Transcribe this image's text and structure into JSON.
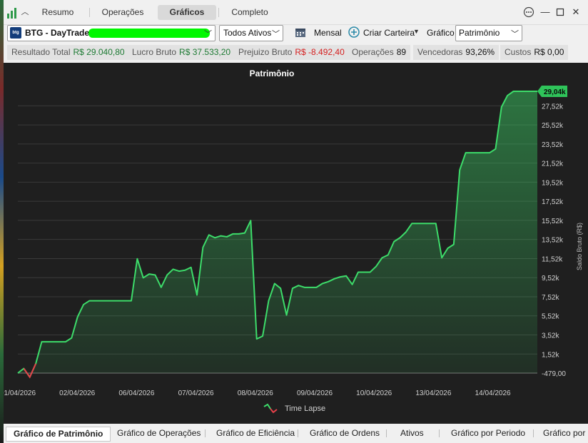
{
  "top_tabs": [
    {
      "label": "Resumo",
      "active": false
    },
    {
      "label": "Operações",
      "active": false
    },
    {
      "label": "Gráficos",
      "active": true
    },
    {
      "label": "Completo",
      "active": false
    }
  ],
  "window_controls": {
    "more": "more-icon",
    "minimize": "minimize-icon",
    "maximize": "maximize-icon",
    "close": "close-icon"
  },
  "toolbar": {
    "account_logo": "btg",
    "account": "BTG - DayTrade",
    "asset_filter": "Todos Ativos",
    "period_label": "Mensal",
    "create_portfolio": "Criar Carteira",
    "chart_label": "Gráfico",
    "chart_type": "Patrimônio"
  },
  "stats": [
    {
      "label": "Resultado Total",
      "value": "R$ 29.040,80",
      "tone": "green"
    },
    {
      "label": "Lucro Bruto",
      "value": "R$ 37.533,20",
      "tone": "green"
    },
    {
      "label": "Prejuizo Bruto",
      "value": "R$ -8.492,40",
      "tone": "red"
    },
    {
      "label": "Operações",
      "value": "89",
      "tone": "dark"
    },
    {
      "label": "Vencedoras",
      "value": "93,26%",
      "tone": "dark"
    },
    {
      "label": "Custos",
      "value": "R$ 0,00",
      "tone": "dark"
    }
  ],
  "colors": {
    "line": "#3ddc6a",
    "negative": "#e8414a",
    "background": "#1f1f1f",
    "grid": "#3a3a3a",
    "current_badge": "#2fc45a"
  },
  "chart_data": {
    "type": "area",
    "title": "Patrimônio",
    "ylabel": "Saldo Bruto (R$)",
    "ylim": [
      -479,
      29040
    ],
    "y_ticks": [
      "27,52k",
      "25,52k",
      "23,52k",
      "21,52k",
      "19,52k",
      "17,52k",
      "15,52k",
      "13,52k",
      "11,52k",
      "9,52k",
      "7,52k",
      "5,52k",
      "3,52k",
      "1,52k",
      "-479,00"
    ],
    "y_tick_values": [
      27520,
      25520,
      23520,
      21520,
      19520,
      17520,
      15520,
      13520,
      11520,
      9520,
      7520,
      5520,
      3520,
      1520,
      -479
    ],
    "current_value_label": "29,04k",
    "x_ticks": [
      "01/04/2026",
      "02/04/2026",
      "06/04/2026",
      "07/04/2026",
      "08/04/2026",
      "09/04/2026",
      "10/04/2026",
      "13/04/2026",
      "14/04/2026"
    ],
    "legend": "Time Lapse",
    "grid": true,
    "series": [
      {
        "values": [
          -479,
          0,
          -900,
          500,
          2800,
          2800,
          2800,
          2800,
          2800,
          3200,
          5400,
          6700,
          7100,
          7100,
          7100,
          7100,
          7100,
          7100,
          7100,
          7100,
          11500,
          9500,
          9900,
          9800,
          8500,
          9800,
          10400,
          10200,
          10300,
          10600,
          7700,
          12700,
          14000,
          13700,
          13900,
          13800,
          14100,
          14100,
          14200,
          15500,
          3100,
          3400,
          7100,
          8900,
          8400,
          5600,
          8400,
          8700,
          8500,
          8500,
          8500,
          8900,
          9100,
          9400,
          9600,
          9700,
          8800,
          10100,
          10100,
          10100,
          10700,
          11600,
          11900,
          13300,
          13700,
          14300,
          15200,
          15200,
          15200,
          15200,
          15200,
          11600,
          12600,
          13000,
          20800,
          22600,
          22600,
          22600,
          22600,
          22600,
          23000,
          27400,
          28600,
          29040,
          29040,
          29040,
          29040,
          29040
        ]
      }
    ]
  },
  "bottom_tabs": [
    {
      "label": "Gráfico de Patrimônio",
      "active": true
    },
    {
      "label": "Gráfico de Operações",
      "active": false
    },
    {
      "label": "Gráfico de Eficiência",
      "active": false
    },
    {
      "label": "Gráfico de Ordens",
      "active": false
    },
    {
      "label": "Ativos",
      "active": false
    },
    {
      "label": "Gráfico por Periodo",
      "active": false
    },
    {
      "label": "Gráfico por C",
      "active": false
    }
  ]
}
